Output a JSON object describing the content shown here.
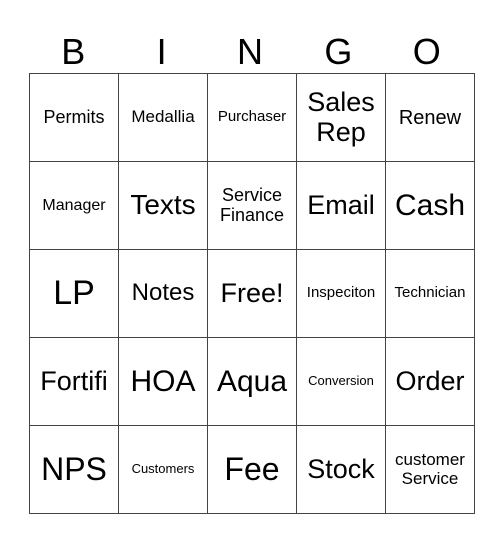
{
  "header": {
    "letters": [
      "B",
      "I",
      "N",
      "G",
      "O"
    ]
  },
  "board": {
    "rows": [
      [
        "Permits",
        "Medallia",
        "Purchaser",
        "Sales Rep",
        "Renew"
      ],
      [
        "Manager",
        "Texts",
        "Service Finance",
        "Email",
        "Cash"
      ],
      [
        "LP",
        "Notes",
        "Free!",
        "Inspeciton",
        "Technician"
      ],
      [
        "Fortifi",
        "HOA",
        "Aqua",
        "Conversion",
        "Order"
      ],
      [
        "NPS",
        "Customers",
        "Fee",
        "Stock",
        "customer Service"
      ]
    ]
  }
}
